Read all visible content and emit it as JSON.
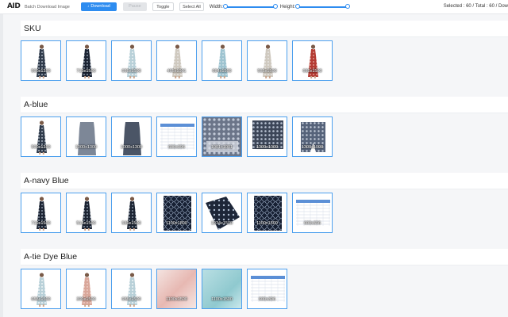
{
  "toolbar": {
    "logo": "AID",
    "app_title": "Batch Download Image",
    "download_label": "Download",
    "download_icon": "↓",
    "pause_label": "Pause",
    "toggle_label": "Toggle",
    "select_all_label": "Select All",
    "width_label": "Width:",
    "height_label": "Height:",
    "width_range": [
      0,
      100
    ],
    "height_range": [
      0,
      100
    ],
    "stats": "Selected : 60 / Total : 60 / Dow"
  },
  "accent": "#2d8cf0",
  "sections": [
    {
      "title": "SKU",
      "images": [
        {
          "dims": "590x1390",
          "kind": "dress-dark"
        },
        {
          "dims": "719x1500",
          "kind": "dress-navy"
        },
        {
          "dims": "658x1500",
          "kind": "dress-light"
        },
        {
          "dims": "465x1001",
          "kind": "dress-pale"
        },
        {
          "dims": "684x1500",
          "kind": "dress-tie"
        },
        {
          "dims": "582x1500",
          "kind": "dress-pale"
        },
        {
          "dims": "682x1500",
          "kind": "dress-red"
        }
      ]
    },
    {
      "title": "A-blue",
      "images": [
        {
          "dims": "590x1390",
          "kind": "dress-dark"
        },
        {
          "dims": "1000x1300",
          "kind": "dress-flat"
        },
        {
          "dims": "1000x1300",
          "kind": "dress-flat-dark"
        },
        {
          "dims": "600x396",
          "kind": "size-chart"
        },
        {
          "dims": "1001x1001",
          "kind": "fabric"
        },
        {
          "dims": "1300x1000",
          "kind": "fabric-dark"
        },
        {
          "dims": "1300x1098",
          "kind": "fabric-shape"
        }
      ]
    },
    {
      "title": "A-navy Blue",
      "images": [
        {
          "dims": "719x1500",
          "kind": "dress-navy"
        },
        {
          "dims": "514x1500",
          "kind": "dress-navy"
        },
        {
          "dims": "589x1500",
          "kind": "dress-navy"
        },
        {
          "dims": "1100x1800",
          "kind": "fabric-navy"
        },
        {
          "dims": "1034x1500",
          "kind": "fabric-fold"
        },
        {
          "dims": "1100x1500",
          "kind": "fabric-navy"
        },
        {
          "dims": "600x396",
          "kind": "size-chart"
        }
      ]
    },
    {
      "title": "A-tie Dye Blue",
      "images": [
        {
          "dims": "658x1500",
          "kind": "dress-light"
        },
        {
          "dims": "390x1500",
          "kind": "dress-back"
        },
        {
          "dims": "658x1500",
          "kind": "dress-light"
        },
        {
          "dims": "1100x1500",
          "kind": "fabric-pink"
        },
        {
          "dims": "1100x1500",
          "kind": "fabric-teal"
        },
        {
          "dims": "600x396",
          "kind": "size-chart"
        }
      ]
    }
  ]
}
